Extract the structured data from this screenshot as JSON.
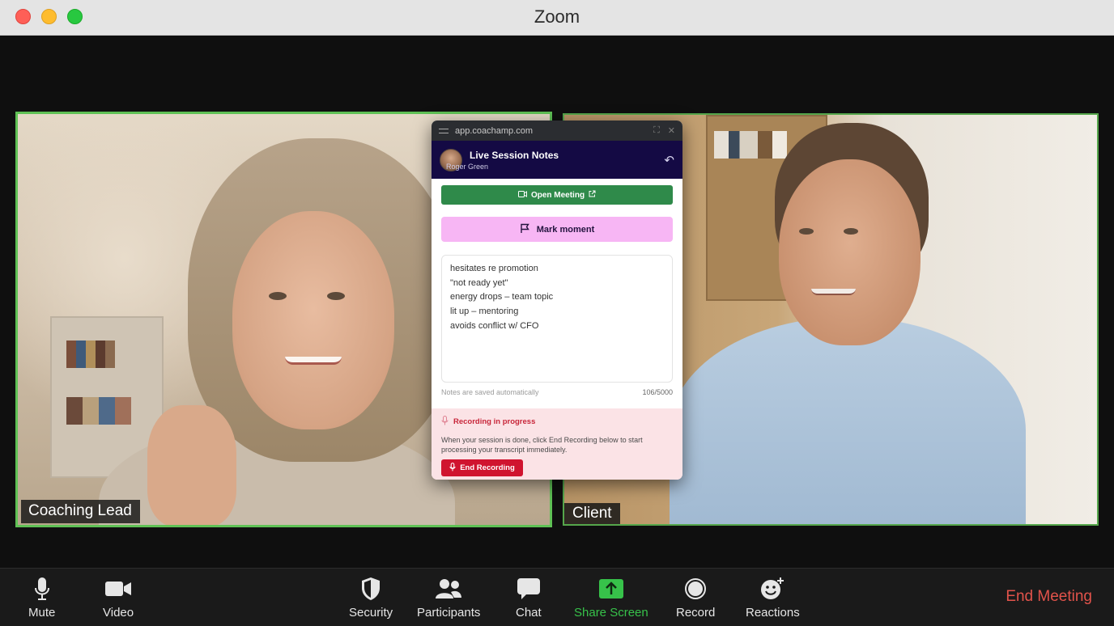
{
  "window": {
    "title": "Zoom"
  },
  "participants": {
    "left": {
      "name": "Coaching Lead"
    },
    "right": {
      "name": "Client"
    }
  },
  "popup": {
    "url": "app.coachamp.com",
    "title": "Live Session Notes",
    "user": "Roger Green",
    "open_meeting_label": "Open Meeting",
    "mark_moment_label": "Mark moment",
    "notes": [
      "hesitates re promotion",
      "\"not ready yet\"",
      "energy drops – team topic",
      "lit up – mentoring",
      "avoids conflict w/ CFO"
    ],
    "autosave_text": "Notes are saved automatically",
    "char_count": "106/5000",
    "recording": {
      "title": "Recording in progress",
      "description": "When your session is done, click End Recording below to start processing your transcript immediately.",
      "end_label": "End Recording"
    }
  },
  "toolbar": {
    "mute": "Mute",
    "video": "Video",
    "security": "Security",
    "participants": "Participants",
    "chat": "Chat",
    "share_screen": "Share Screen",
    "record": "Record",
    "reactions": "Reactions",
    "end_meeting": "End Meeting"
  },
  "colors": {
    "active_speaker_border": "#5fc155",
    "share_screen_green": "#37c24a",
    "end_meeting_red": "#e2534b",
    "popup_header": "#140a44",
    "mark_moment_pink": "#f7b6f4",
    "open_meeting_green": "#2f8a4a"
  }
}
